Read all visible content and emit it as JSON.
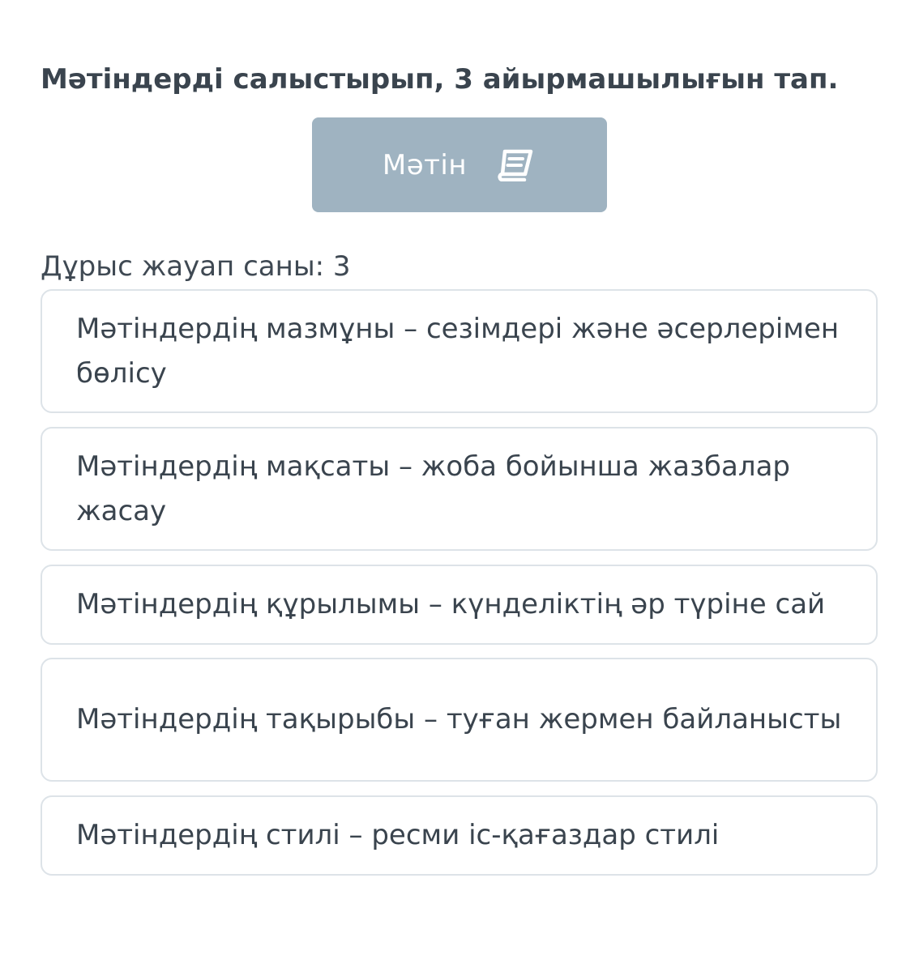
{
  "question": {
    "text": "Мәтіндерді салыстырып, 3 айырмашылығын тап."
  },
  "text_button": {
    "label": "Мәтін",
    "icon": "book-icon"
  },
  "answers_count": {
    "text": "Дұрыс жауап саны: 3"
  },
  "options": [
    {
      "text": "Мәтіндердің мазмұны – сезімдері және әсерлерімен бөлісу"
    },
    {
      "text": "Мәтіндердің мақсаты – жоба бойынша жазбалар жасау"
    },
    {
      "text": "Мәтіндердің құрылымы – күнделіктің әр түріне сай"
    },
    {
      "text": "Мәтіндердің тақырыбы – туған жермен байланысты"
    },
    {
      "text": "Мәтіндердің стилі – ресми іс-қағаздар стилі"
    }
  ],
  "colors": {
    "button_bg": "#9fb3c1",
    "option_border": "#dde3e8",
    "text": "#3a444e"
  }
}
